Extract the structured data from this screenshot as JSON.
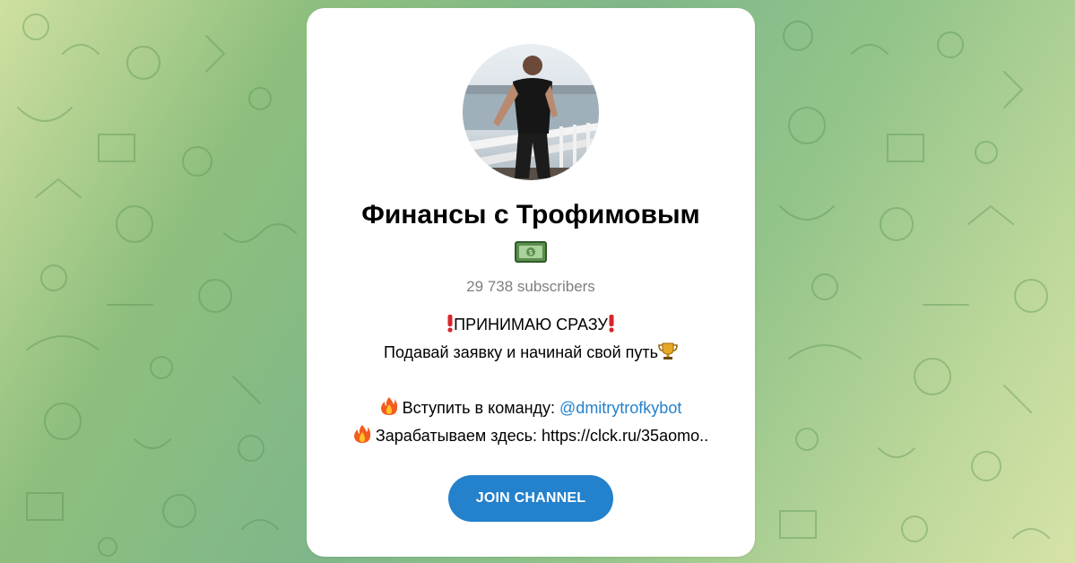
{
  "channel": {
    "title": "Финансы с Трофимовым",
    "title_emoji_icon": "money-bill-icon",
    "subscribers": "29 738 subscribers"
  },
  "description": {
    "line1_icon": "exclamation-icon",
    "line1": "ПРИНИМАЮ СРАЗУ",
    "line2": "Подавай заявку и начинай свой путь",
    "line2_icon": "trophy-icon",
    "line3_icon": "fire-icon",
    "line3_text": "Вступить в команду: ",
    "line3_link": "@dmitrytrofkybot",
    "line4_icon": "fire-icon",
    "line4_text": "Зарабатываем здесь: https://clck.ru/35aomo.."
  },
  "join_button": {
    "label": "JOIN CHANNEL"
  },
  "colors": {
    "accent": "#2481cc",
    "muted": "#7d7f81"
  }
}
